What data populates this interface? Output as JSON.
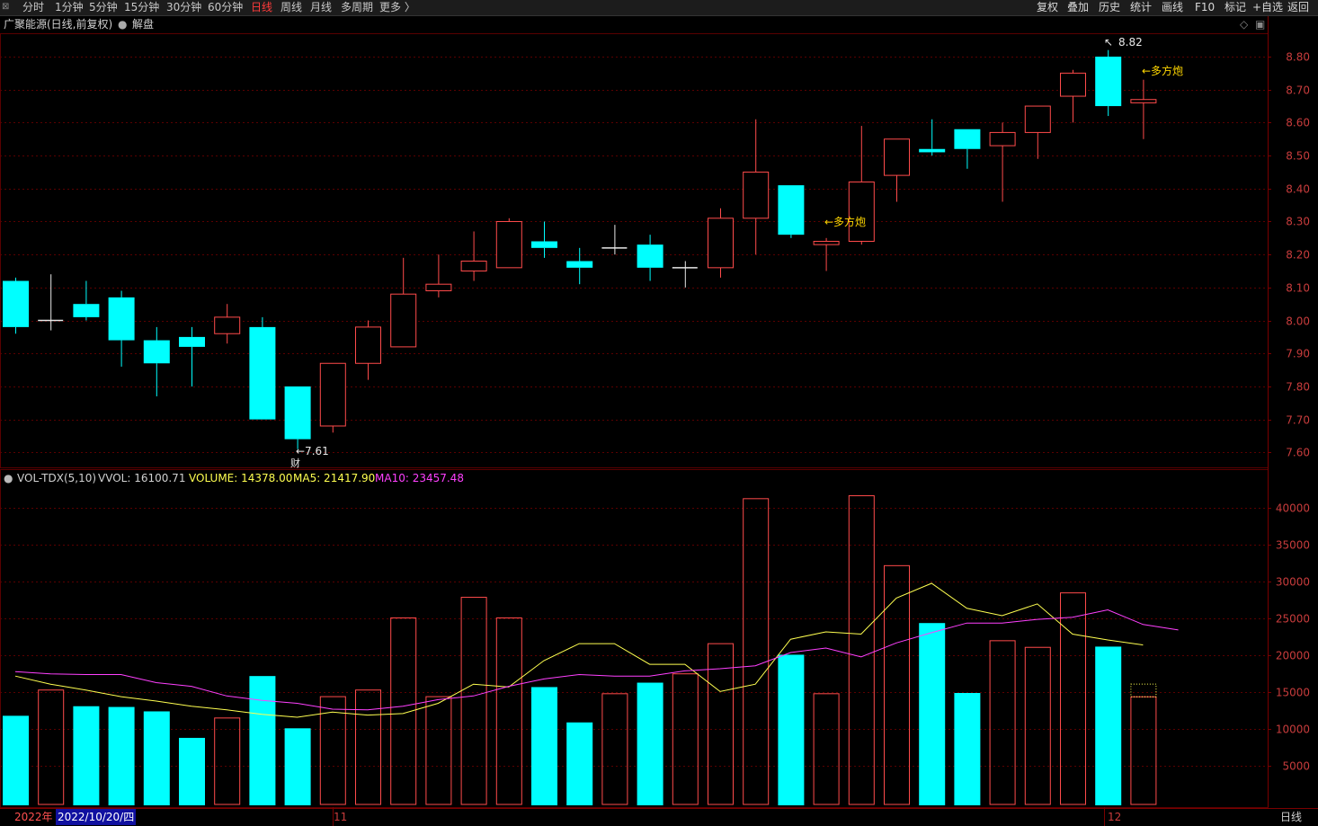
{
  "toolbar": {
    "periods": [
      "分时",
      "1分钟",
      "5分钟",
      "15分钟",
      "30分钟",
      "60分钟",
      "日线",
      "周线",
      "月线",
      "多周期",
      "更多 〉"
    ],
    "active_period": "日线",
    "right_buttons": [
      "复权",
      "叠加",
      "历史",
      "统计",
      "画线",
      "F10",
      "标记",
      "+自选",
      "返回"
    ]
  },
  "header": {
    "stock_title": "广聚能源(日线,前复权)",
    "jiepan": "解盘"
  },
  "indicator": {
    "name": "VOL-TDX(5,10)",
    "vvol": "VVOL: 16100.71",
    "volume": "VOLUME: 14378.00",
    "ma5": "MA5: 21417.90",
    "ma10": "MA10: 23457.48"
  },
  "annotations": {
    "low_label": "←7.61",
    "cai": "财",
    "high_label": "8.82",
    "signal1": "←多方炮",
    "signal2": "←多方炮"
  },
  "footer": {
    "year": "2022年",
    "cursor_date": "2022/10/20/四",
    "month_11": "11",
    "month_12": "12",
    "period_label": "日线"
  },
  "colors": {
    "up": "#ff4b4b",
    "down": "#00ffff",
    "ma5": "#ffff50",
    "ma10": "#ff40ff",
    "grid": "#5a0000",
    "axis_text": "#c83c3c"
  },
  "chart_data": [
    {
      "type": "candlestick",
      "title": "广聚能源(日线,前复权)",
      "ylim": [
        7.56,
        8.86
      ],
      "y_ticks": [
        "8.80",
        "8.70",
        "8.60",
        "8.50",
        "8.40",
        "8.30",
        "8.20",
        "8.10",
        "8.00",
        "7.90",
        "7.80",
        "7.70",
        "7.60"
      ],
      "candles": [
        {
          "o": 8.12,
          "h": 8.13,
          "l": 7.96,
          "c": 7.98
        },
        {
          "o": 8.0,
          "h": 8.14,
          "l": 7.97,
          "c": 8.0
        },
        {
          "o": 8.05,
          "h": 8.12,
          "l": 8.0,
          "c": 8.01
        },
        {
          "o": 8.07,
          "h": 8.09,
          "l": 7.86,
          "c": 7.94
        },
        {
          "o": 7.94,
          "h": 7.98,
          "l": 7.77,
          "c": 7.87
        },
        {
          "o": 7.95,
          "h": 7.98,
          "l": 7.8,
          "c": 7.92
        },
        {
          "o": 7.96,
          "h": 8.05,
          "l": 7.93,
          "c": 8.01
        },
        {
          "o": 7.98,
          "h": 8.01,
          "l": 7.7,
          "c": 7.7
        },
        {
          "o": 7.8,
          "h": 7.8,
          "l": 7.61,
          "c": 7.64
        },
        {
          "o": 7.68,
          "h": 7.87,
          "l": 7.66,
          "c": 7.87
        },
        {
          "o": 7.87,
          "h": 8.0,
          "l": 7.82,
          "c": 7.98
        },
        {
          "o": 7.92,
          "h": 8.19,
          "l": 7.92,
          "c": 8.08
        },
        {
          "o": 8.09,
          "h": 8.2,
          "l": 8.07,
          "c": 8.11
        },
        {
          "o": 8.15,
          "h": 8.27,
          "l": 8.12,
          "c": 8.18
        },
        {
          "o": 8.16,
          "h": 8.31,
          "l": 8.16,
          "c": 8.3
        },
        {
          "o": 8.24,
          "h": 8.3,
          "l": 8.19,
          "c": 8.22
        },
        {
          "o": 8.18,
          "h": 8.22,
          "l": 8.11,
          "c": 8.16
        },
        {
          "o": 8.22,
          "h": 8.29,
          "l": 8.2,
          "c": 8.22
        },
        {
          "o": 8.23,
          "h": 8.26,
          "l": 8.12,
          "c": 8.16
        },
        {
          "o": 8.16,
          "h": 8.18,
          "l": 8.1,
          "c": 8.16
        },
        {
          "o": 8.16,
          "h": 8.34,
          "l": 8.13,
          "c": 8.31
        },
        {
          "o": 8.31,
          "h": 8.61,
          "l": 8.2,
          "c": 8.45
        },
        {
          "o": 8.41,
          "h": 8.41,
          "l": 8.25,
          "c": 8.26
        },
        {
          "o": 8.23,
          "h": 8.25,
          "l": 8.15,
          "c": 8.24
        },
        {
          "o": 8.24,
          "h": 8.59,
          "l": 8.23,
          "c": 8.42
        },
        {
          "o": 8.44,
          "h": 8.55,
          "l": 8.36,
          "c": 8.55
        },
        {
          "o": 8.52,
          "h": 8.61,
          "l": 8.5,
          "c": 8.51
        },
        {
          "o": 8.58,
          "h": 8.58,
          "l": 8.46,
          "c": 8.52
        },
        {
          "o": 8.53,
          "h": 8.6,
          "l": 8.36,
          "c": 8.57
        },
        {
          "o": 8.57,
          "h": 8.65,
          "l": 8.49,
          "c": 8.65
        },
        {
          "o": 8.68,
          "h": 8.76,
          "l": 8.6,
          "c": 8.75
        },
        {
          "o": 8.8,
          "h": 8.82,
          "l": 8.62,
          "c": 8.65
        },
        {
          "o": 8.66,
          "h": 8.73,
          "l": 8.55,
          "c": 8.67
        }
      ]
    },
    {
      "type": "bar",
      "title": "VOL-TDX(5,10)",
      "ylim": [
        0,
        42500
      ],
      "y_ticks": [
        "40000",
        "35000",
        "30000",
        "25000",
        "20000",
        "15000",
        "10000",
        "5000"
      ],
      "volumes": [
        11800,
        15300,
        13100,
        13000,
        12400,
        8800,
        11500,
        17200,
        10100,
        14400,
        15300,
        25100,
        14400,
        27900,
        25100,
        15700,
        10900,
        14800,
        16300,
        17500,
        21600,
        41300,
        20100,
        14800,
        41700,
        32200,
        24400,
        14900,
        22000,
        21100,
        28500,
        21200,
        14378
      ],
      "series": [
        {
          "name": "MA5",
          "values": [
            17200,
            16100,
            15300,
            14400,
            13800,
            13100,
            12600,
            12000,
            11600,
            12300,
            11900,
            12100,
            13500,
            16100,
            15700,
            19300,
            21600,
            21600,
            18800,
            18800,
            15100,
            16100,
            22200,
            23200,
            22900,
            27800,
            29800,
            26400,
            25400,
            27000,
            22900,
            22100,
            21418
          ]
        },
        {
          "name": "MA10",
          "values": [
            17800,
            17500,
            17400,
            17400,
            16300,
            15800,
            14500,
            13900,
            13500,
            12700,
            12600,
            13100,
            14000,
            14500,
            15800,
            16800,
            17400,
            17200,
            17200,
            17900,
            18200,
            18600,
            20400,
            21000,
            19800,
            21700,
            23100,
            24400,
            24400,
            24900,
            25200,
            26200,
            24200,
            23457
          ]
        }
      ],
      "annotations_header": {
        "VVOL": "16100.71",
        "VOLUME": "14378.00",
        "MA5": "21417.90",
        "MA10": "23457.48"
      }
    }
  ]
}
